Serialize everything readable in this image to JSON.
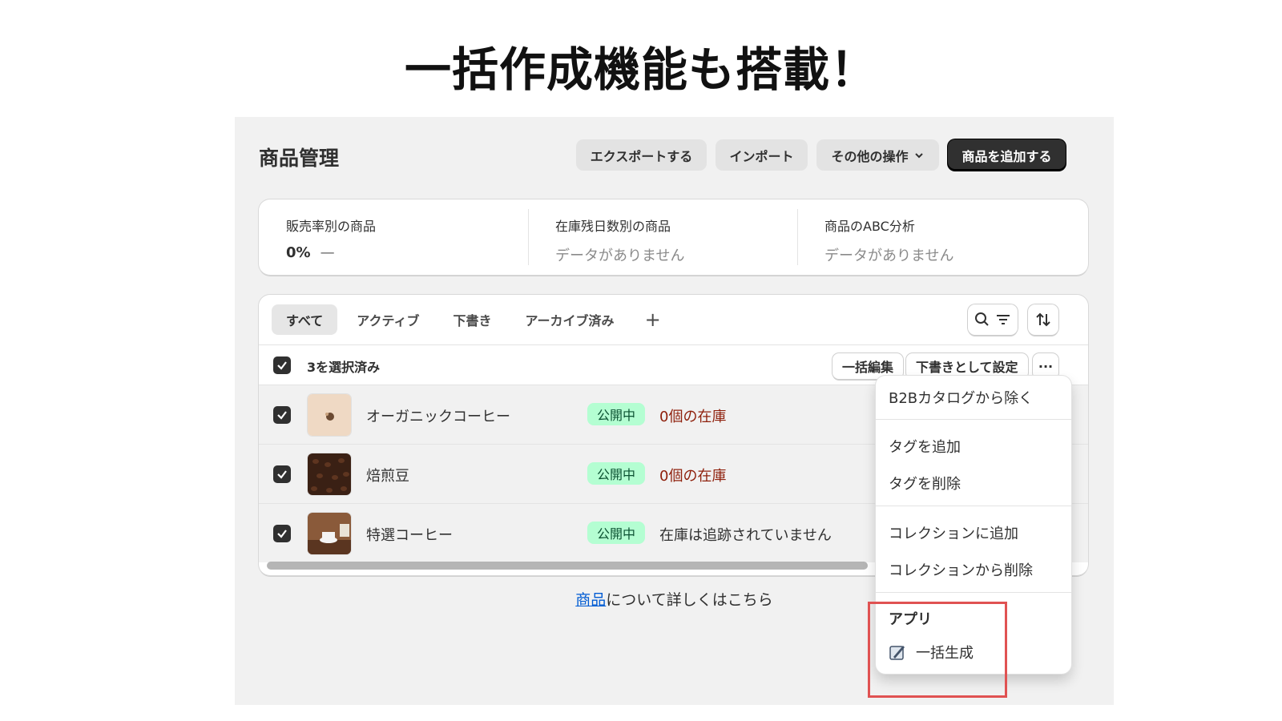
{
  "headline": "一括作成機能も搭載！",
  "page": {
    "title": "商品管理",
    "buttons": {
      "export": "エクスポートする",
      "import": "インポート",
      "more_actions": "その他の操作",
      "add_product": "商品を追加する"
    }
  },
  "stats": [
    {
      "label": "販売率別の商品",
      "value": "0%",
      "trend": "—"
    },
    {
      "label": "在庫残日数別の商品",
      "empty": "データがありません"
    },
    {
      "label": "商品のABC分析",
      "empty": "データがありません"
    }
  ],
  "tabs": [
    "すべて",
    "アクティブ",
    "下書き",
    "アーカイブ済み"
  ],
  "tab_add": "+",
  "bulk": {
    "selected_label": "3を選択済み",
    "bulk_edit": "一括編集",
    "set_draft": "下書きとして設定",
    "more": "···"
  },
  "products": [
    {
      "name": "オーガニックコーヒー",
      "status": "公開中",
      "inventory": "0個の在庫"
    },
    {
      "name": "焙煎豆",
      "status": "公開中",
      "inventory": "0個の在庫"
    },
    {
      "name": "特選コーヒー",
      "status": "公開中",
      "inventory": "在庫は追跡されていません"
    }
  ],
  "footer": {
    "link": "商品",
    "text": "について詳しくはこちら"
  },
  "menu": {
    "items": [
      "B2Bカタログから除く",
      "タグを追加",
      "タグを削除",
      "コレクションに追加",
      "コレクションから削除"
    ],
    "apps_heading": "アプリ",
    "app_item": "一括生成"
  },
  "colors": {
    "badge_bg": "#b4fed2",
    "stock_red": "#8e1f0b",
    "link": "#005bd3",
    "highlight": "#e05252"
  }
}
